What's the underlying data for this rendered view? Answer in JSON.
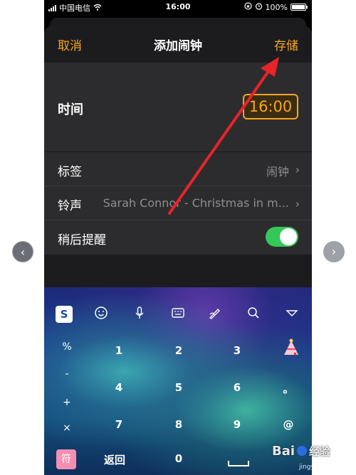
{
  "status_bar": {
    "carrier": "中国电信",
    "time": "16:00",
    "battery": "100%"
  },
  "nav": {
    "cancel": "取消",
    "title": "添加闹钟",
    "save": "存储"
  },
  "time_row": {
    "label": "时间",
    "value": "16:00"
  },
  "rows": [
    {
      "label": "标签",
      "value": "闹钟"
    },
    {
      "label": "铃声",
      "value": "Sarah Connor - Christmas in m..."
    },
    {
      "label": "稍后提醒",
      "toggle_on": true
    }
  ],
  "keyboard": {
    "toolbar_icons": [
      "sogou-icon",
      "emoji-icon",
      "microphone-icon",
      "keyboard-icon",
      "handwriting-icon",
      "search-icon",
      "collapse-icon"
    ],
    "sogou_label": "S",
    "side_keys": [
      "%",
      "-",
      "+",
      "×"
    ],
    "digits": [
      "1",
      "2",
      "3",
      "4",
      "5",
      "6",
      "7",
      "8",
      "9",
      "0"
    ],
    "punct": [
      "。",
      "@"
    ],
    "back_label": "返回",
    "gift_label": "符"
  },
  "gallery": {
    "prev": "‹",
    "next": "›"
  },
  "watermark": {
    "text": "Bai 经验",
    "sub": "jingyan.baidu.com"
  },
  "colors": {
    "accent": "#f5a623",
    "toggle": "#34c759",
    "annotation": "#e8232a"
  }
}
